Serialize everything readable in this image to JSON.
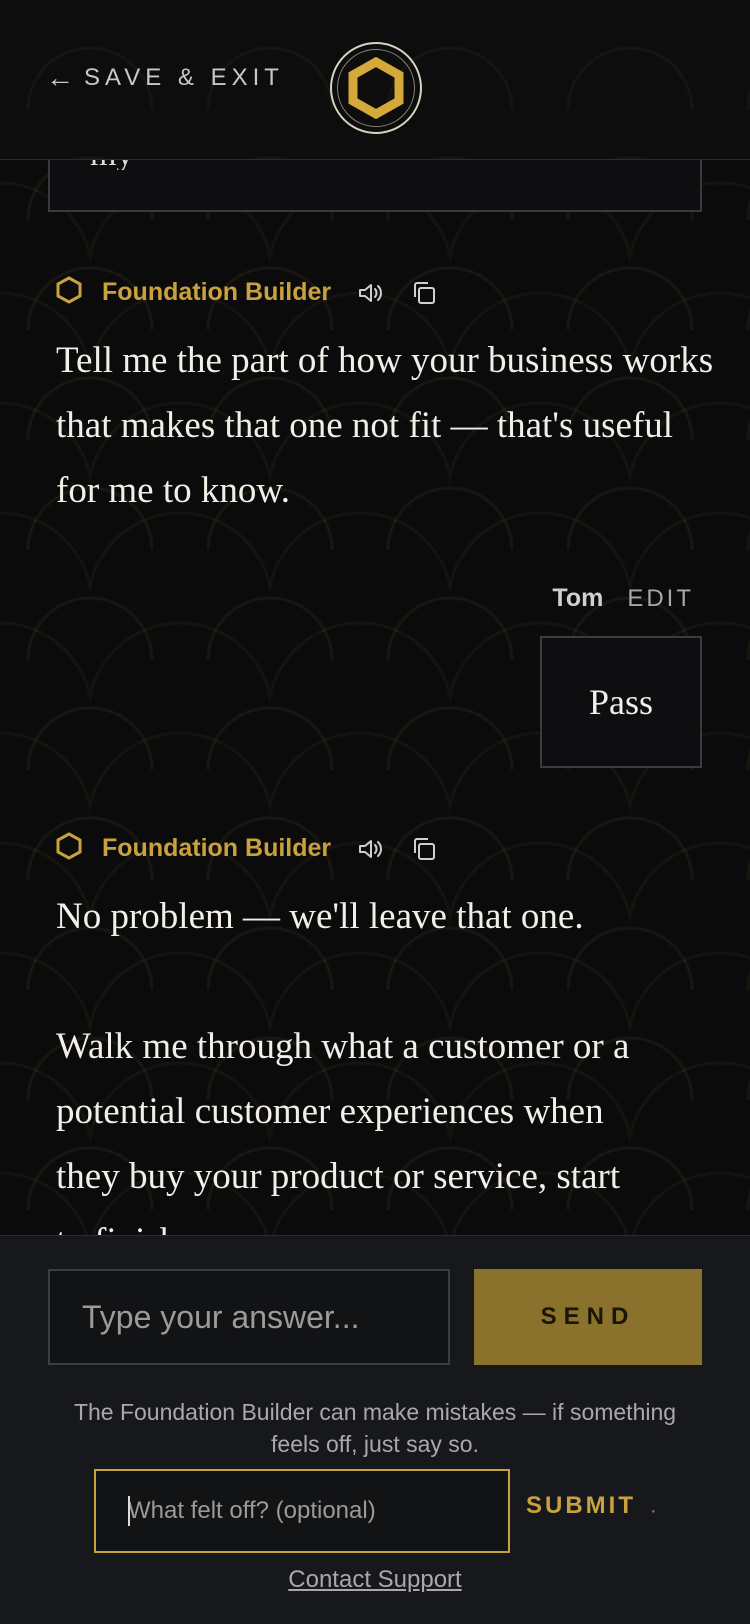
{
  "header": {
    "back_label": "SAVE & EXIT",
    "back_arrow": "←",
    "logo_icon": "hexagon-logo-icon",
    "accent_color": "#c9a13e"
  },
  "previous_answer_fragment": "my",
  "messages": [
    {
      "role": "assistant",
      "sender": "Foundation Builder",
      "icons": [
        "hexagon-icon",
        "speaker-icon",
        "copy-icon"
      ],
      "paragraphs": [
        "Tell me the part of how your business works that makes that one not fit — that's useful for me to know."
      ]
    },
    {
      "role": "user",
      "sender": "Tom",
      "edit_label": "EDIT",
      "text": "Pass"
    },
    {
      "role": "assistant",
      "sender": "Foundation Builder",
      "icons": [
        "hexagon-icon",
        "speaker-icon",
        "copy-icon"
      ],
      "paragraphs": [
        "No problem — we'll leave that one.",
        "Walk me through what a customer or a potential customer experiences when they buy your product or service, start to finish."
      ]
    }
  ],
  "composer": {
    "input_placeholder": "Type your answer...",
    "send_label": "SEND",
    "disclaimer": "The Foundation Builder can make mistakes — if something feels off, just say so.",
    "feedback_placeholder": "What felt off? (optional)",
    "submit_label": "SUBMIT",
    "separator": "·",
    "support_label": "Contact Support"
  }
}
